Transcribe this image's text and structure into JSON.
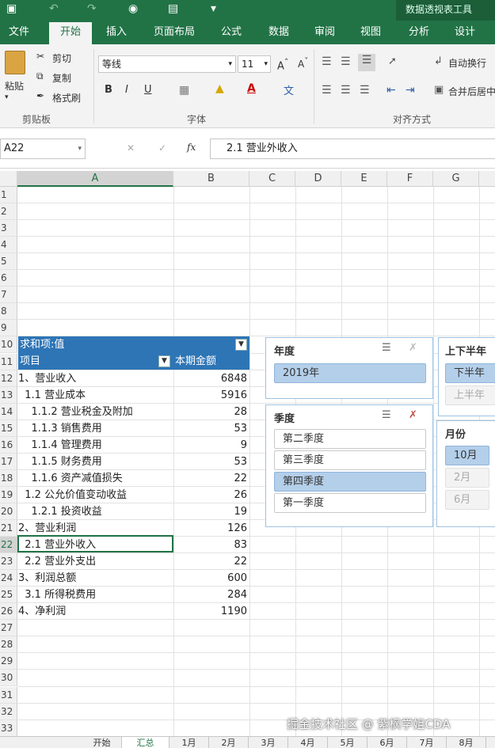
{
  "titlebar": {
    "context_label": "数据透视表工具"
  },
  "ribbon_tabs": [
    "文件",
    "开始",
    "插入",
    "页面布局",
    "公式",
    "数据",
    "审阅",
    "视图",
    "分析",
    "设计"
  ],
  "ribbon": {
    "paste": "粘贴",
    "cut": "剪切",
    "copy": "复制",
    "format_painter": "格式刷",
    "clipboard_group": "剪贴板",
    "font_name": "等线",
    "font_size": "11",
    "font_group": "字体",
    "wrap_text": "自动换行",
    "merge_center": "合并后居中",
    "align_group": "对齐方式",
    "bold": "B",
    "italic": "I",
    "underline": "U"
  },
  "formula_bar": {
    "name_box": "A22",
    "formula": "2.1 营业外收入"
  },
  "columns": [
    "A",
    "B",
    "C",
    "D",
    "E",
    "F",
    "G"
  ],
  "rows": [
    "1",
    "2",
    "3",
    "4",
    "5",
    "6",
    "7",
    "8",
    "9",
    "10",
    "11",
    "12",
    "13",
    "14",
    "15",
    "16",
    "17",
    "18",
    "19",
    "20",
    "21",
    "22",
    "23",
    "24",
    "25",
    "26",
    "27",
    "28",
    "29",
    "30",
    "31",
    "32",
    "33"
  ],
  "pivot": {
    "header_label": "求和项:值",
    "row_label": "项目",
    "col_label": "本期金额",
    "items": [
      {
        "label": "1、营业收入",
        "value": "6848"
      },
      {
        "label": "  1.1 营业成本",
        "value": "5916"
      },
      {
        "label": "    1.1.2 营业税金及附加",
        "value": "28"
      },
      {
        "label": "    1.1.3 销售费用",
        "value": "53"
      },
      {
        "label": "    1.1.4 管理费用",
        "value": "9"
      },
      {
        "label": "    1.1.5 财务费用",
        "value": "53"
      },
      {
        "label": "    1.1.6 资产减值损失",
        "value": "22"
      },
      {
        "label": "  1.2 公允价值变动收益",
        "value": "26"
      },
      {
        "label": "    1.2.1 投资收益",
        "value": "19"
      },
      {
        "label": "2、营业利润",
        "value": "126"
      },
      {
        "label": "  2.1 营业外收入",
        "value": "83"
      },
      {
        "label": "  2.2 营业外支出",
        "value": "22"
      },
      {
        "label": "3、利润总额",
        "value": "600"
      },
      {
        "label": "  3.1 所得税费用",
        "value": "284"
      },
      {
        "label": "4、净利润",
        "value": "1190"
      }
    ]
  },
  "slicers": {
    "year": {
      "title": "年度",
      "items": [
        "2019年"
      ]
    },
    "half": {
      "title": "上下半年",
      "items": [
        "下半年",
        "上半年"
      ]
    },
    "quarter": {
      "title": "季度",
      "items": [
        "第二季度",
        "第三季度",
        "第四季度",
        "第一季度"
      ]
    },
    "month": {
      "title": "月份",
      "items": [
        "10月",
        "2月",
        "6月"
      ]
    }
  },
  "sheet_tabs": [
    "开始",
    "汇总",
    "1月",
    "2月",
    "3月",
    "4月",
    "5月",
    "6月",
    "7月",
    "8月"
  ],
  "watermark": "掘金技术社区 @ 紫枫学姐CDA",
  "colors": {
    "excel_green": "#217346",
    "pivot_blue": "#2e75b6",
    "slicer_selected": "#b4cfea"
  }
}
